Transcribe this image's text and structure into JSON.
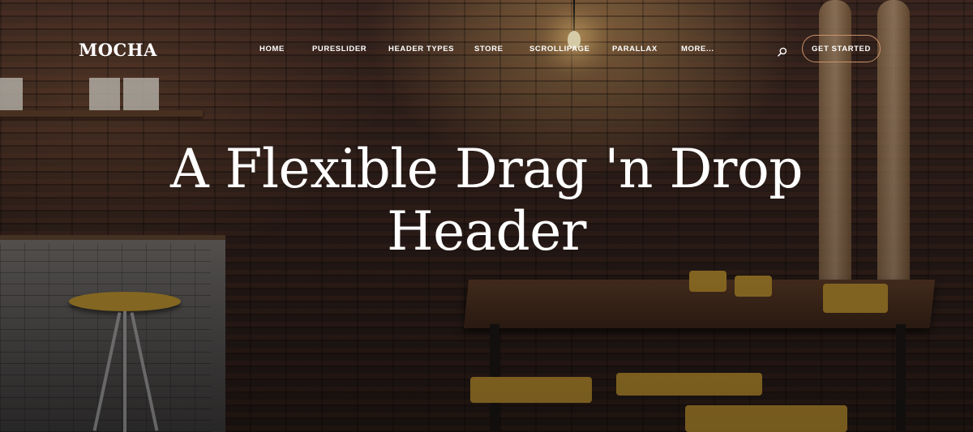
{
  "header": {
    "logo": "MOCHA",
    "nav": [
      {
        "label": "HOME"
      },
      {
        "label": "PURESLIDER"
      },
      {
        "label": "HEADER TYPES"
      },
      {
        "label": "STORE"
      },
      {
        "label": "SCROLLIPAGE"
      },
      {
        "label": "PARALLAX"
      },
      {
        "label": "MORE..."
      }
    ],
    "search_icon": "search-icon",
    "cta_label": "GET STARTED"
  },
  "hero": {
    "headline_line1": "A Flexible Drag 'n Drop",
    "headline_line2": "Header"
  },
  "colors": {
    "cta_border": "#c9936a",
    "text": "#ffffff"
  }
}
